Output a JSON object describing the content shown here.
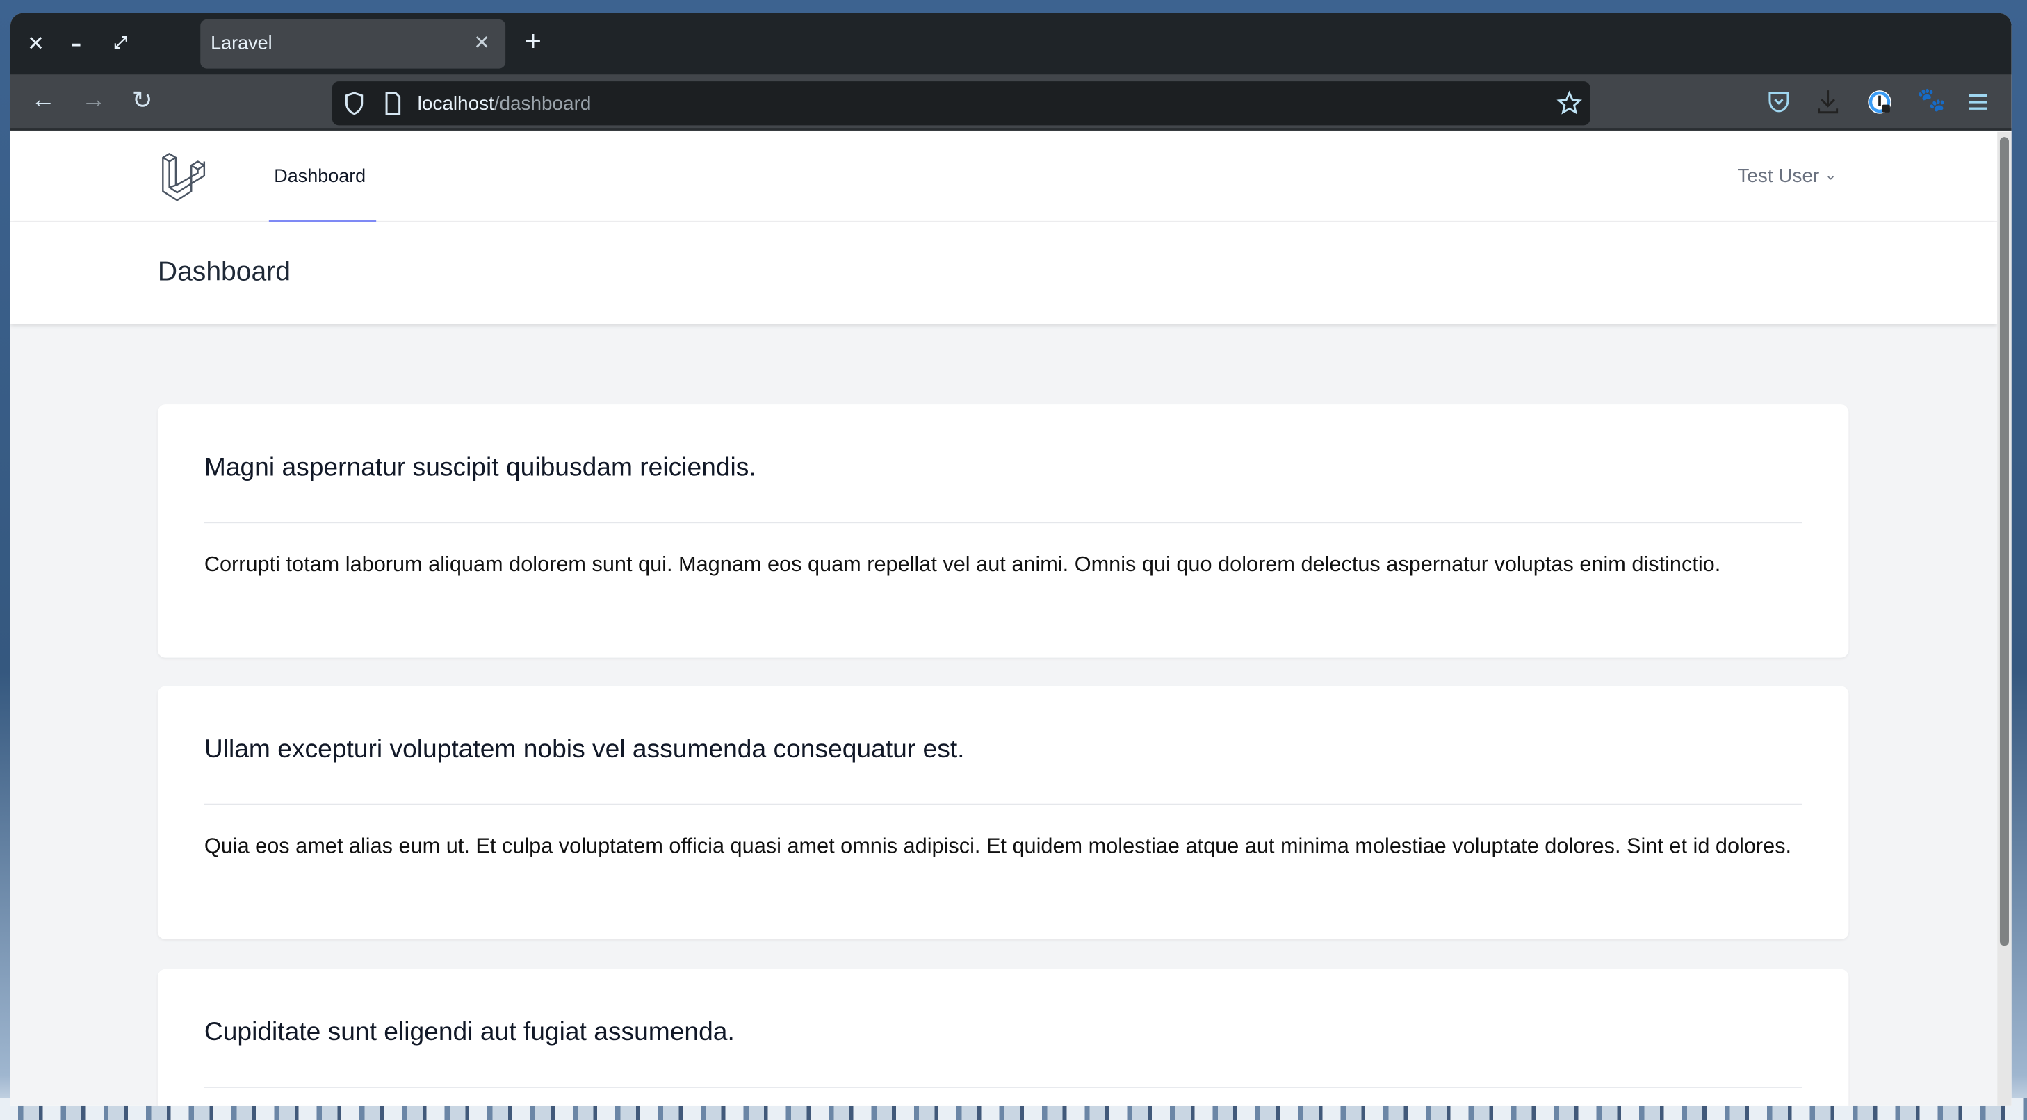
{
  "browser": {
    "tab_title": "Laravel",
    "url_host": "localhost",
    "url_path": "/dashboard"
  },
  "app": {
    "nav_link": "Dashboard",
    "user_name": "Test User",
    "page_title": "Dashboard"
  },
  "posts": [
    {
      "title": "Magni aspernatur suscipit quibusdam reiciendis.",
      "body": "Corrupti totam laborum aliquam dolorem sunt qui. Magnam eos quam repellat vel aut animi. Omnis qui quo dolorem delectus aspernatur voluptas enim distinctio."
    },
    {
      "title": "Ullam excepturi voluptatem nobis vel assumenda consequatur est.",
      "body": "Quia eos amet alias eum ut. Et culpa voluptatem officia quasi amet omnis adipisci. Et quidem molestiae atque aut minima molestiae voluptate dolores. Sint et id dolores."
    },
    {
      "title": "Cupiditate sunt eligendi aut fugiat assumenda."
    }
  ],
  "colors": {
    "accent": "#818cf8",
    "page_bg": "#f3f4f6"
  }
}
